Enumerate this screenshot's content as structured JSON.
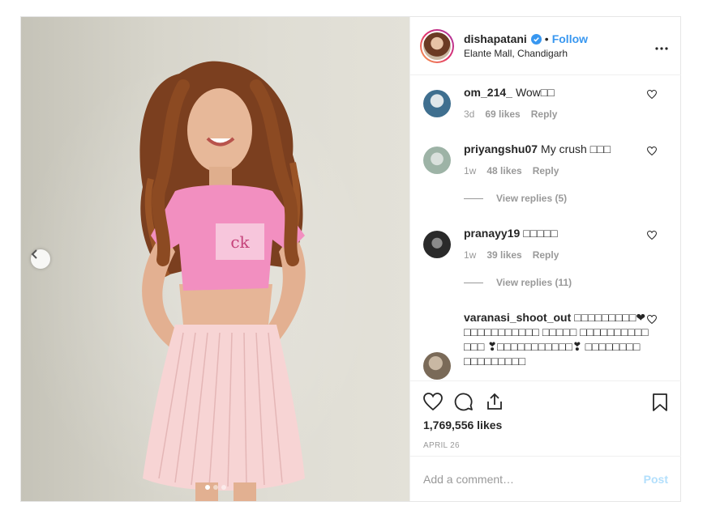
{
  "post": {
    "author": {
      "username": "dishapatani",
      "verified": true,
      "follow_label": "Follow",
      "separator": "•",
      "location": "Elante Mall, Chandigarh"
    },
    "photo": {
      "alt_icon": "chevron-left-icon",
      "carousel_dots": 3,
      "active_dot": 1
    },
    "comments": [
      {
        "username": "om_214_",
        "text": "Wow□□",
        "age": "3d",
        "likes": "69 likes",
        "reply": "Reply",
        "avatar_color": "#3f6f8f"
      },
      {
        "username": "priyangshu07",
        "text": "My crush □□□",
        "age": "1w",
        "likes": "48 likes",
        "reply": "Reply",
        "view_replies": "View replies (5)",
        "avatar_color": "#9db3a6"
      },
      {
        "username": "pranayy19",
        "text": "□□□□□",
        "age": "1w",
        "likes": "39 likes",
        "reply": "Reply",
        "view_replies": "View replies (11)",
        "avatar_color": "#2a2a2a"
      },
      {
        "username": "varanasi_shoot_out",
        "text": "□□□□□□□□□❤ □□□□□□□□□□□ □□□□□ □□□□□□□□□□□□□ ❣□□□□□□□□□□□❣ □□□□□□□□ □□□□□□□□□",
        "avatar_color": "#7a6a58"
      }
    ],
    "actions": {
      "like_icon": "heart-icon",
      "comment_icon": "comment-icon",
      "share_icon": "share-icon",
      "save_icon": "bookmark-icon"
    },
    "likes_count": "1,769,556 likes",
    "date": "APRIL 26",
    "add_comment": {
      "placeholder": "Add a comment…",
      "post_label": "Post"
    }
  },
  "colors": {
    "link": "#3897f0",
    "post_disabled": "#b2dffc",
    "muted": "#999999",
    "text": "#262626"
  }
}
